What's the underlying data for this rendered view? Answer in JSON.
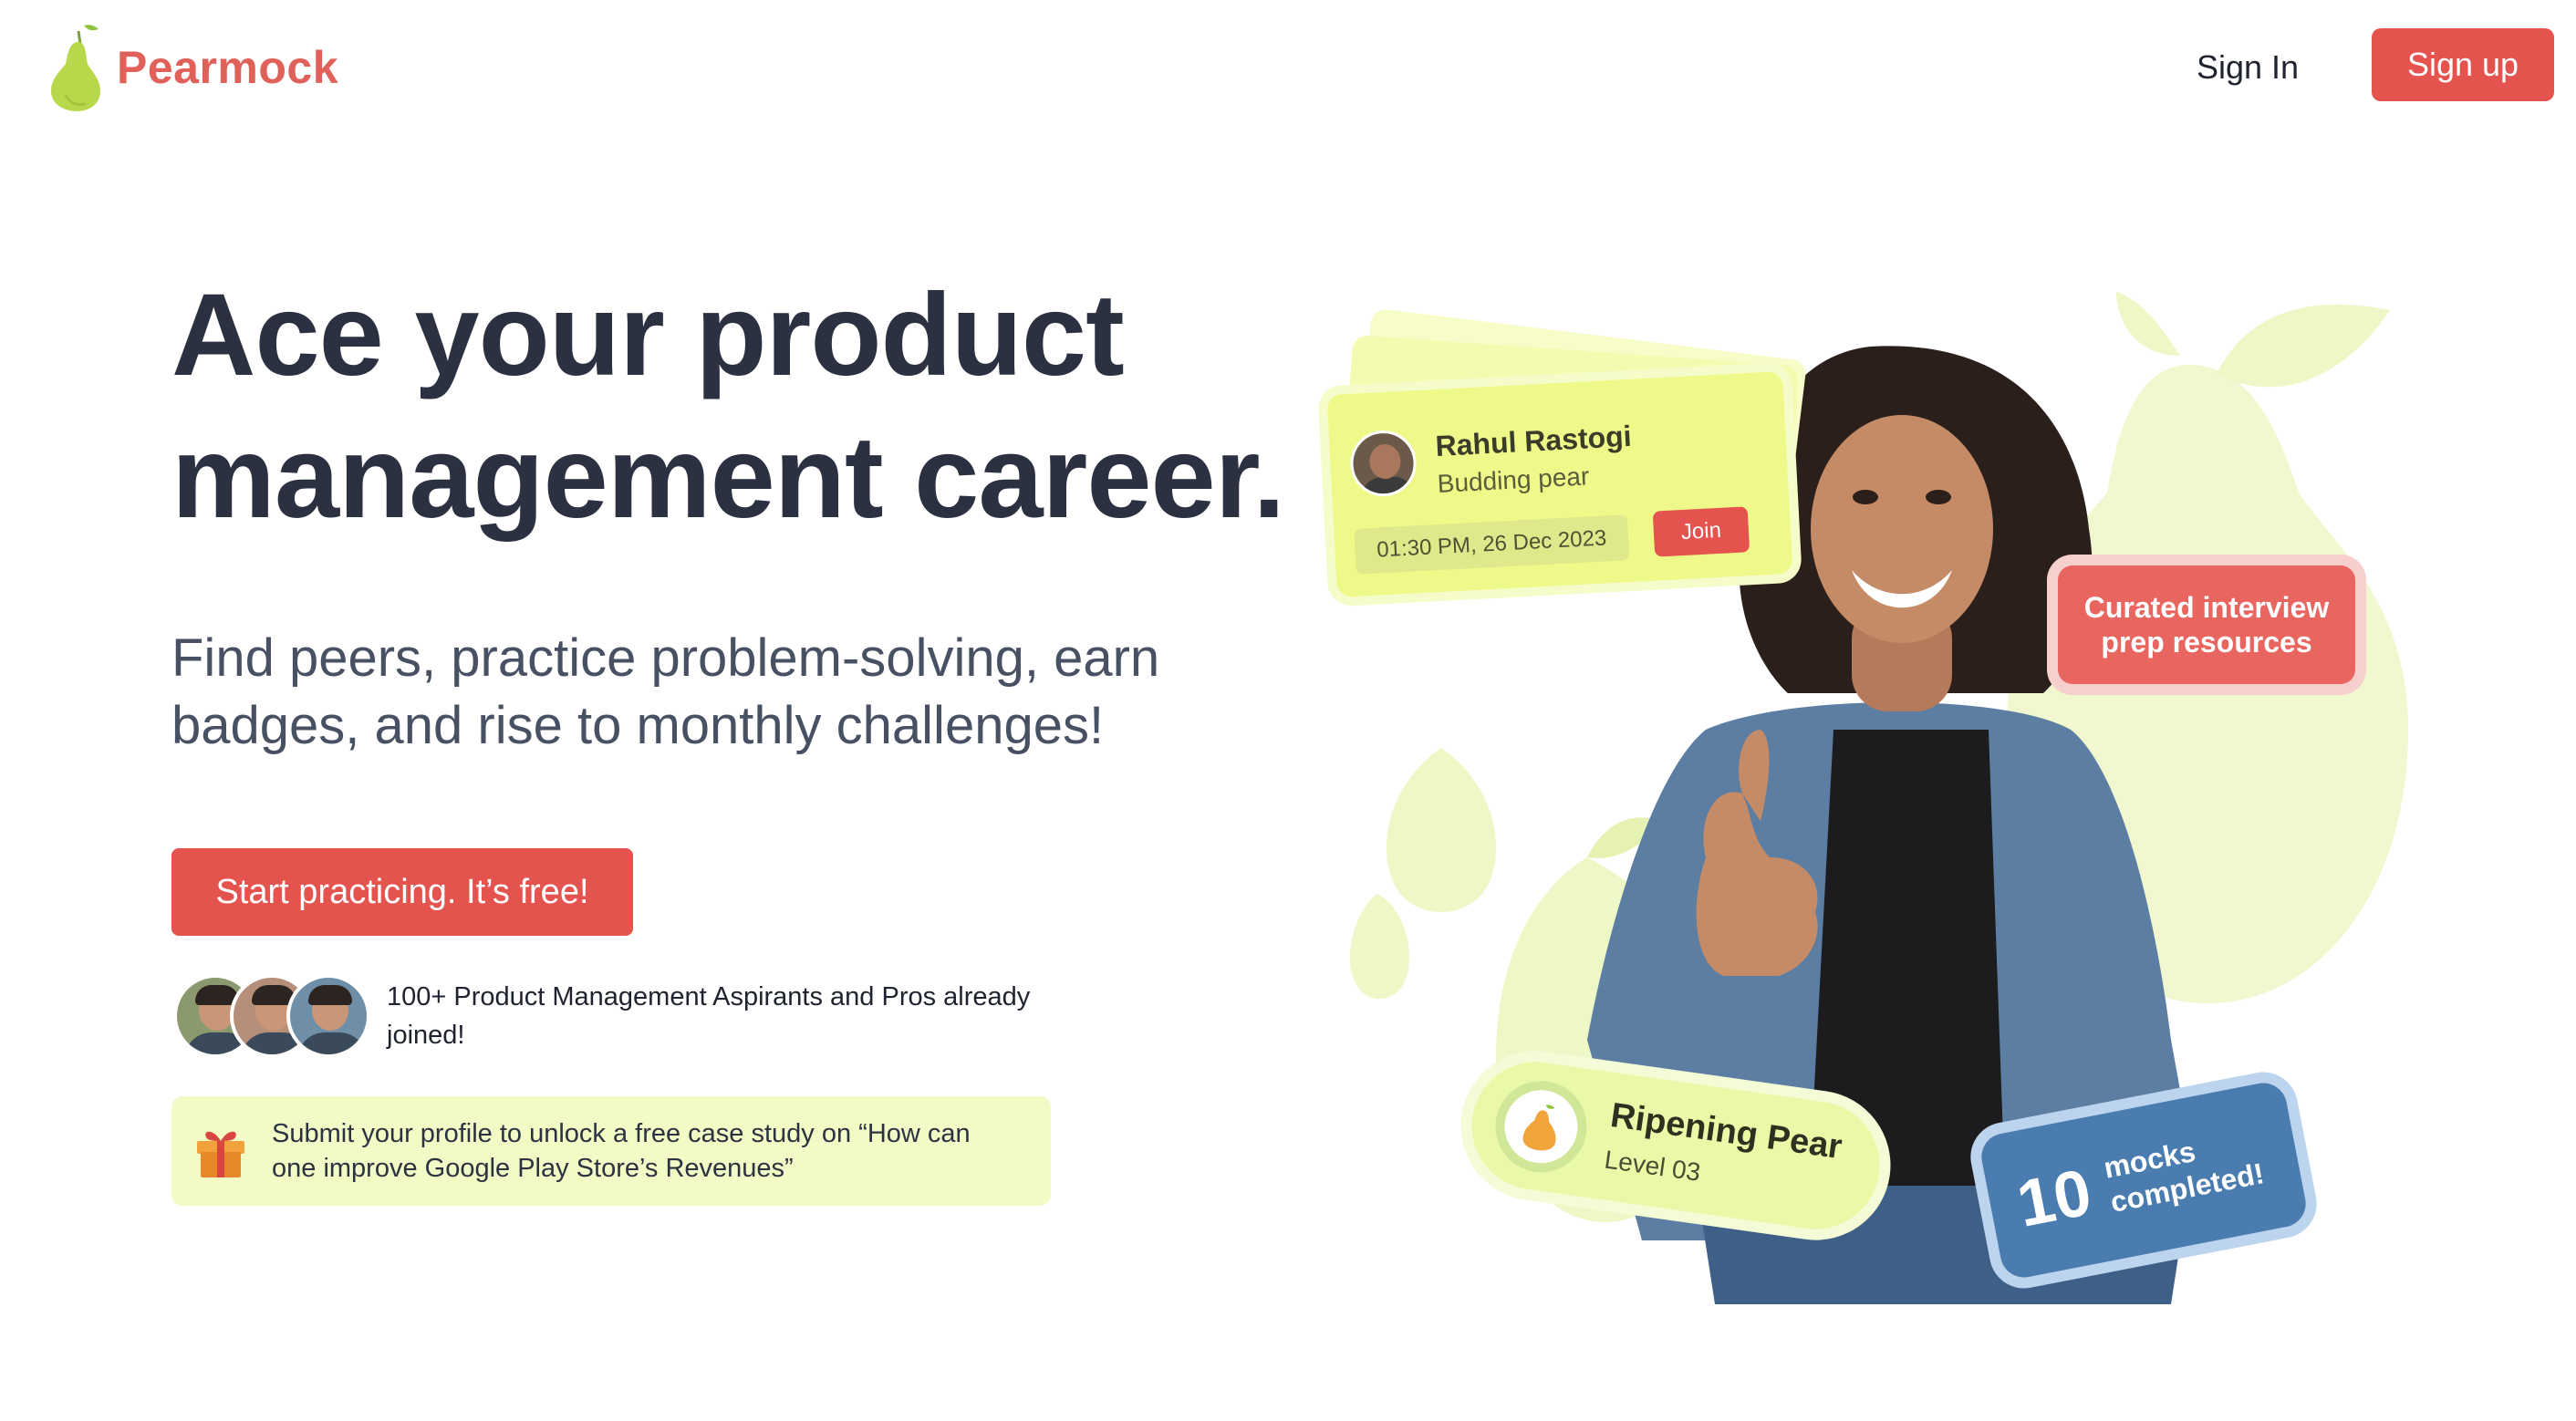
{
  "header": {
    "brand": "Pearmock",
    "sign_in": "Sign In",
    "sign_up": "Sign up"
  },
  "hero": {
    "headline_line1": "Ace your product",
    "headline_line2": "management career.",
    "subhead": "Find peers, practice problem-solving, earn badges, and rise to monthly challenges!",
    "cta": "Start practicing. It’s free!",
    "joined": "100+ Product Management Aspirants and Pros already joined!",
    "promo": "Submit your profile to unlock a free case study on “How can one improve Google Play Store’s Revenues”"
  },
  "illustration": {
    "session_card": {
      "name": "Rahul Rastogi",
      "role": "Budding pear",
      "time": "01:30 PM, 26 Dec 2023",
      "join": "Join"
    },
    "curated": "Curated interview prep resources",
    "badge": {
      "title": "Ripening Pear",
      "level": "Level 03"
    },
    "mocks": {
      "count": "10",
      "label": "mocks completed!"
    }
  },
  "colors": {
    "brand_red": "#e5534f",
    "headline": "#2b3141",
    "promo_bg": "#f2fbc5",
    "pear_green": "#b7d84a",
    "mocks_blue": "#4a7cb0"
  },
  "icons": [
    "pear-logo-icon",
    "gift-icon",
    "pear-badge-icon"
  ]
}
